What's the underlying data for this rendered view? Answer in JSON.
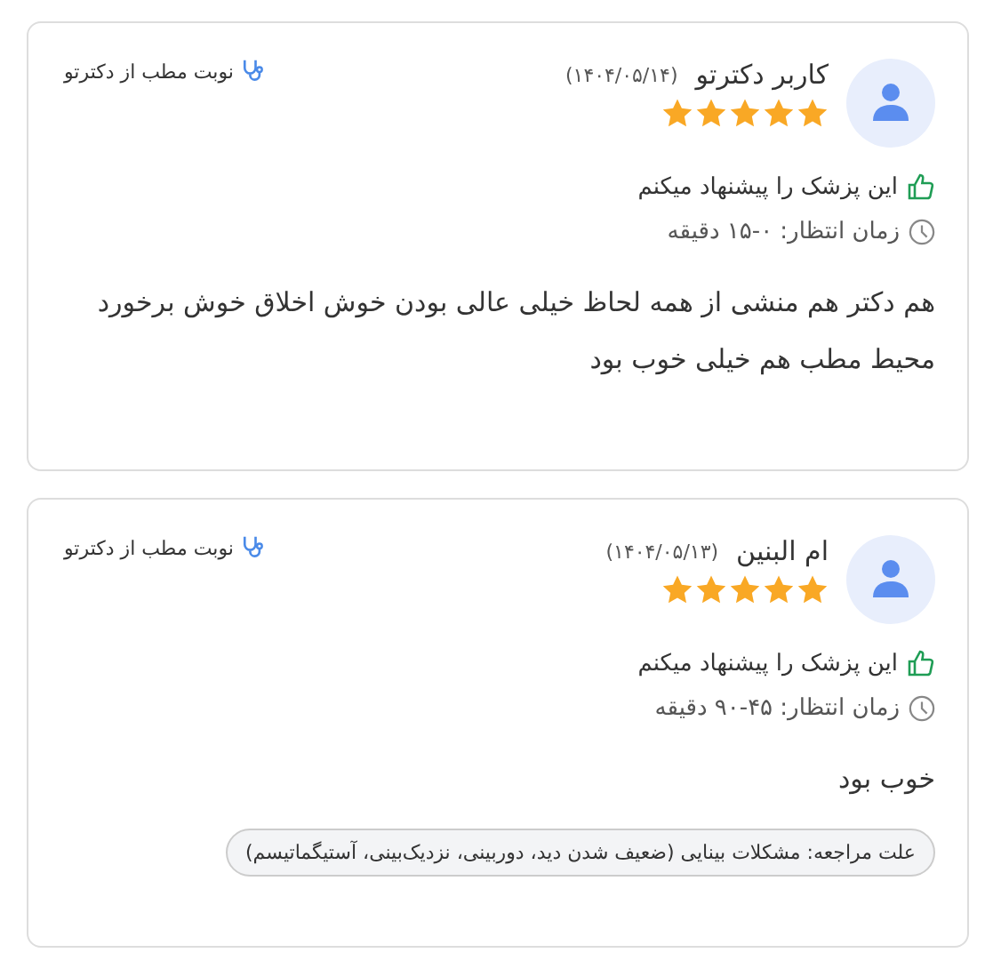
{
  "reviews": [
    {
      "name": "کاربر دکترتو",
      "date": "(۱۴۰۴/۰۵/۱۴)",
      "stars": 5,
      "source": "نوبت مطب از دکترتو",
      "recommended": true,
      "recommend_text": "این پزشک را پیشنهاد میکنم",
      "wait": "زمان انتظار: ۰-۱۵ دقیقه",
      "comment": "هم دکتر هم منشی از همه لحاظ خیلی عالی بودن خوش اخلاق خوش برخورد محیط مطب هم خیلی خوب بود"
    },
    {
      "name": "ام البنین",
      "date": "(۱۴۰۴/۰۵/۱۳)",
      "stars": 5,
      "source": "نوبت مطب از دکترتو",
      "recommended": true,
      "recommend_text": "این پزشک را پیشنهاد میکنم",
      "wait": "زمان انتظار: ۴۵-۹۰ دقیقه",
      "comment": "خوب بود",
      "reason": "علت مراجعه: مشکلات بینایی (ضعیف شدن دید، دوربینی، نزدیک‌بینی، آستیگماتیسم)"
    }
  ]
}
